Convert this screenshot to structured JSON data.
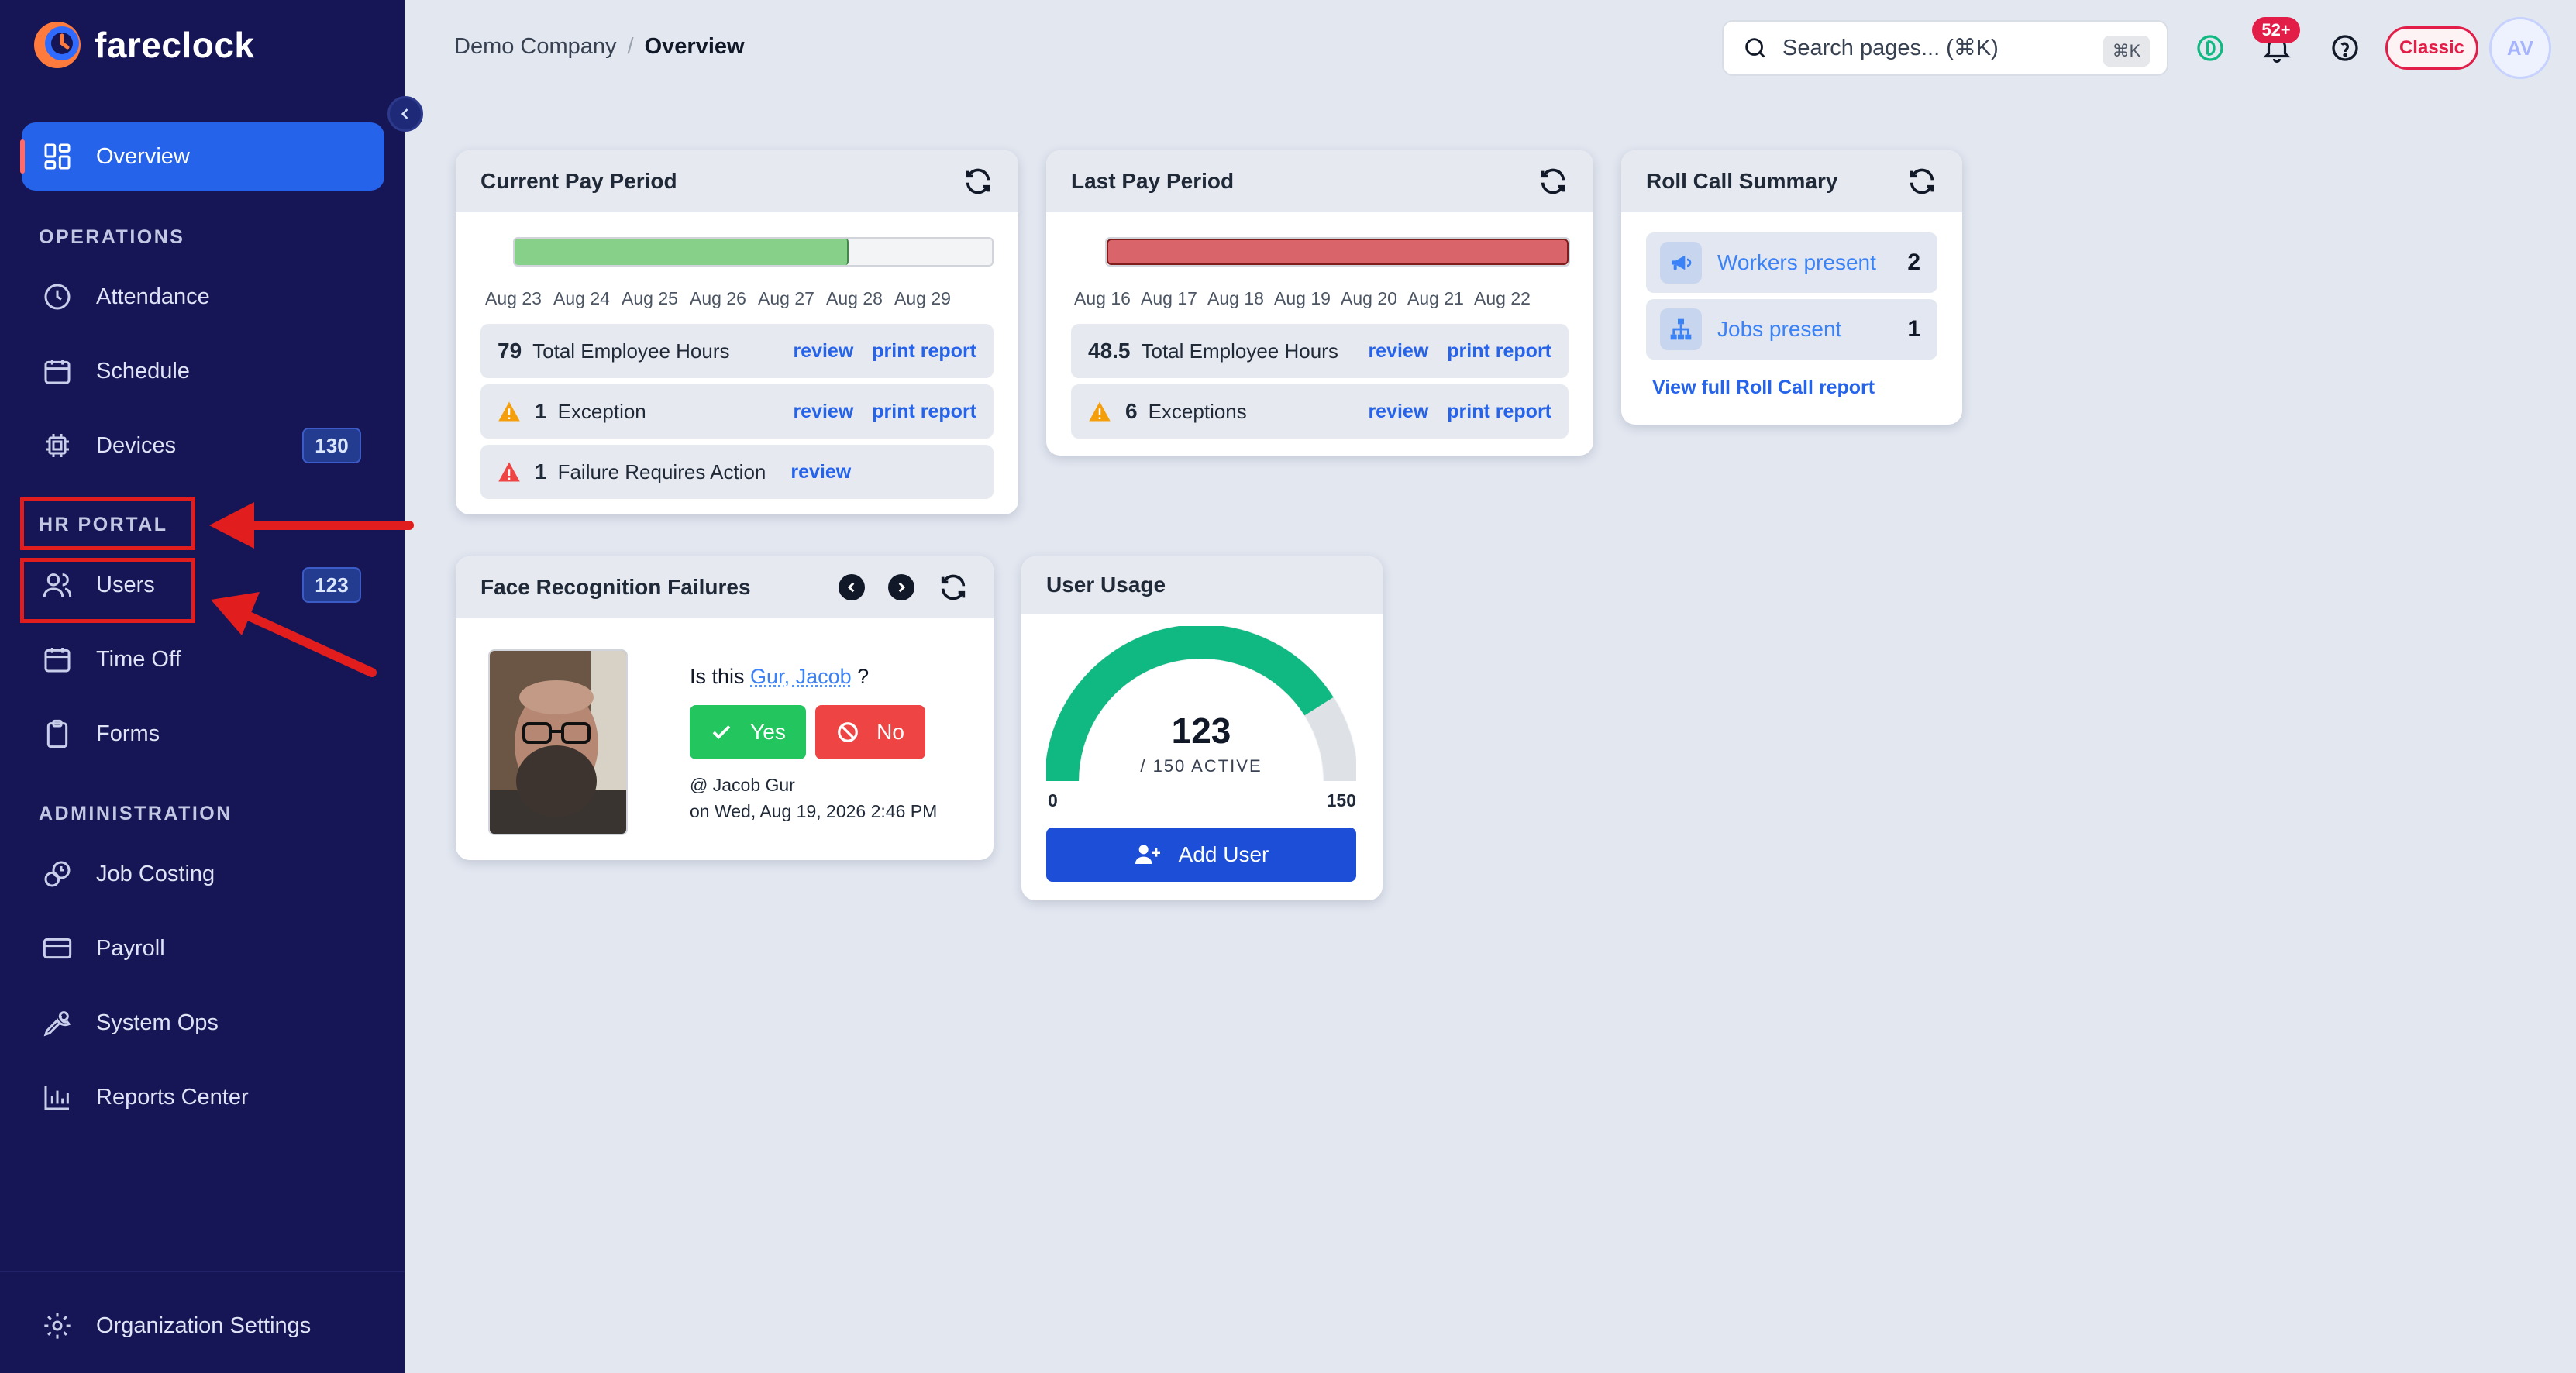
{
  "app": {
    "name": "fareclock"
  },
  "sidebar": {
    "overview": "Overview",
    "sections": {
      "operations": "OPERATIONS",
      "hr_portal": "HR PORTAL",
      "administration": "ADMINISTRATION"
    },
    "items": {
      "attendance": "Attendance",
      "schedule": "Schedule",
      "devices": "Devices",
      "devices_count": "130",
      "users": "Users",
      "users_count": "123",
      "time_off": "Time Off",
      "forms": "Forms",
      "job_costing": "Job Costing",
      "payroll": "Payroll",
      "system_ops": "System Ops",
      "reports_center": "Reports Center",
      "org_settings": "Organization Settings"
    },
    "annotation_color": "#e11d1d"
  },
  "header": {
    "breadcrumb": [
      "Demo Company",
      "/",
      "Overview"
    ],
    "search_placeholder": "Search pages... (⌘K)",
    "search_shortcut": "⌘K",
    "notifications_badge": "52+",
    "classic_label": "Classic",
    "avatar_initials": "AV"
  },
  "current_pay_period": {
    "title": "Current Pay Period",
    "progress": 0.7,
    "bar_color": "#86d08a",
    "dates": [
      "Aug 23",
      "Aug 24",
      "Aug 25",
      "Aug 26",
      "Aug 27",
      "Aug 28",
      "Aug 29"
    ],
    "rows": [
      {
        "num": "79",
        "label": "Total Employee Hours",
        "review": "review",
        "print": "print report"
      },
      {
        "num": "1",
        "label": "Exception",
        "review": "review",
        "print": "print report",
        "icon": "warning-icon"
      },
      {
        "num": "1",
        "label": "Failure Requires Action",
        "review": "review",
        "icon": "alert-icon"
      }
    ]
  },
  "last_pay_period": {
    "title": "Last Pay Period",
    "progress": 1.0,
    "bar_color": "#d9646a",
    "dates": [
      "Aug 16",
      "Aug 17",
      "Aug 18",
      "Aug 19",
      "Aug 20",
      "Aug 21",
      "Aug 22"
    ],
    "rows": [
      {
        "num": "48.5",
        "label": "Total Employee Hours",
        "review": "review",
        "print": "print report"
      },
      {
        "num": "6",
        "label": "Exceptions",
        "review": "review",
        "print": "print report",
        "icon": "warning-icon"
      }
    ]
  },
  "roll_call": {
    "title": "Roll Call Summary",
    "workers_label": "Workers present",
    "workers_count": "2",
    "jobs_label": "Jobs present",
    "jobs_count": "1",
    "full_report": "View full Roll Call report"
  },
  "face_recognition": {
    "title": "Face Recognition Failures",
    "question_prefix": "Is this",
    "person": "Gur, Jacob",
    "question_suffix": "?",
    "yes": "Yes",
    "no": "No",
    "at_name": "@ Jacob Gur",
    "timestamp": "on Wed, Aug 19, 2026 2:46 PM"
  },
  "user_usage": {
    "title": "User Usage",
    "active": "123",
    "total_label": "/ 150 ACTIVE",
    "min": "0",
    "max": "150",
    "fraction": 0.82,
    "gauge_color": "#10b981",
    "add_user": "Add User"
  }
}
